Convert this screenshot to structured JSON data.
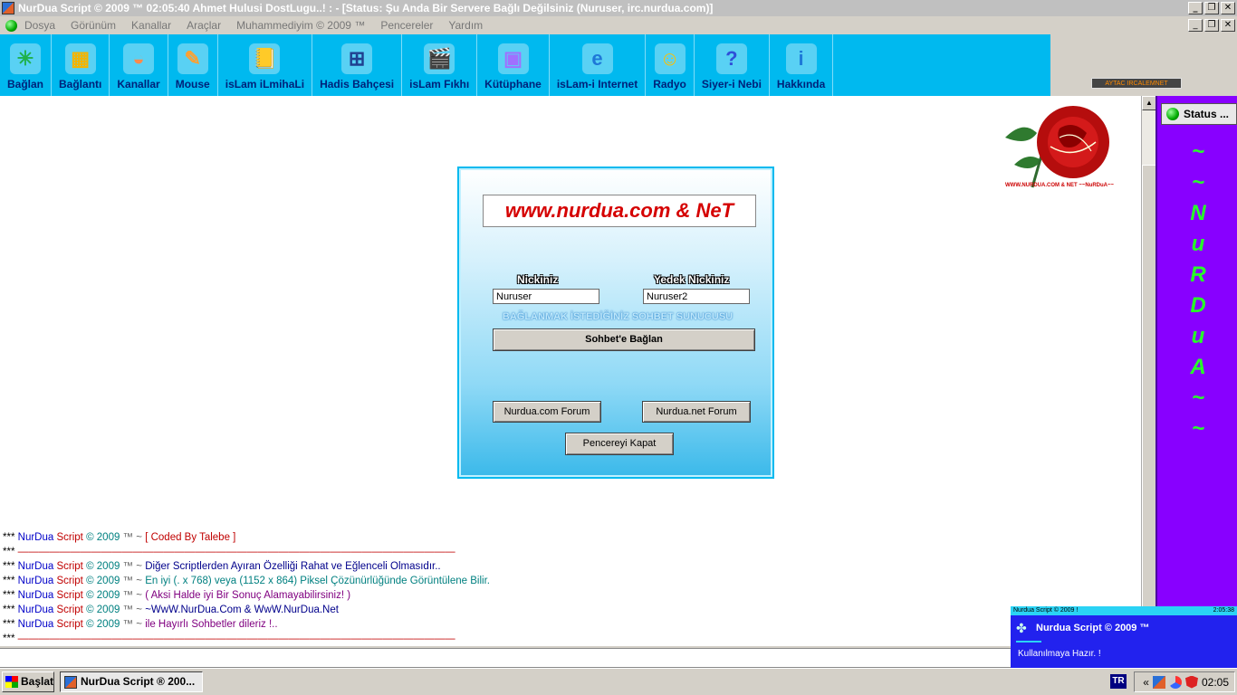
{
  "window": {
    "title": "NurDua Script © 2009 ™ 02:05:40 Ahmet Hulusi DostLugu..! : - [Status: Şu Anda Bir Servere Bağlı Değilsiniz (Nuruser, irc.nurdua.com)]",
    "min_glyph": "_",
    "restore_glyph": "❐",
    "close_glyph": "✕"
  },
  "menubar": {
    "items": [
      "Dosya",
      "Görünüm",
      "Kanallar",
      "Araçlar",
      "Muhammediyim © 2009 ™",
      "Pencereler",
      "Yardım"
    ]
  },
  "toolbar": {
    "buttons": [
      {
        "label": "Bağlan",
        "icon": "connect-icon",
        "glyph": "✳",
        "color": "#1fb14a"
      },
      {
        "label": "Bağlantı",
        "icon": "blocks-icon",
        "glyph": "▦",
        "color": "#f4b400"
      },
      {
        "label": "Kanallar",
        "icon": "bowl-icon",
        "glyph": "◒",
        "color": "#ff8a4c"
      },
      {
        "label": "Mouse",
        "icon": "tools-icon",
        "glyph": "✎",
        "color": "#ffa030"
      },
      {
        "label": "isLam iLmihaLi",
        "icon": "book-icon",
        "glyph": "📒",
        "color": "#ffcf44"
      },
      {
        "label": "Hadis Bahçesi",
        "icon": "windows-icon",
        "glyph": "⊞",
        "color": "#1f3f8f"
      },
      {
        "label": "isLam Fıkhı",
        "icon": "clapper-icon",
        "glyph": "🎬",
        "color": "#333333"
      },
      {
        "label": "Kütüphane",
        "icon": "gameboy-icon",
        "glyph": "▣",
        "color": "#a070ff"
      },
      {
        "label": "isLam-i Internet",
        "icon": "ie-icon",
        "glyph": "e",
        "color": "#1e78d8"
      },
      {
        "label": "Radyo",
        "icon": "chat-face-icon",
        "glyph": "☺",
        "color": "#ffbf00"
      },
      {
        "label": "Siyer-i Nebi",
        "icon": "help-icon",
        "glyph": "?",
        "color": "#2f4fd8"
      },
      {
        "label": "Hakkında",
        "icon": "info-icon",
        "glyph": "i",
        "color": "#1d7ad8"
      }
    ]
  },
  "brand_badge": "AYTAC IRCALEMNET",
  "rose_caption": "WWW.NURDUA.COM & NET ~~NuRDuA~~",
  "dialog": {
    "brand": "www.nurdua.com & NeT",
    "nick_label": "Nickiniz",
    "alt_nick_label": "Yedek Nickiniz",
    "nick_value": "Nuruser",
    "alt_nick_value": "Nuruser2",
    "server_label": "BAĞLANMAK İSTEDİĞİNİZ SOHBET SUNUCUSU",
    "connect_button": "Sohbet'e Bağlan",
    "forum_com_button": "Nurdua.com Forum",
    "forum_net_button": "Nurdua.net Forum",
    "close_button": "Pencereyi Kapat"
  },
  "chat_prefix": {
    "stars": "***",
    "nurdua": "NurDua",
    "script": "Script",
    "copy": "©",
    "year": "2009",
    "tm": "™",
    "sep": "~"
  },
  "chat_lines": [
    {
      "kind": "full",
      "tail": "[ Coded By Talebe ]",
      "tail_style": "k-tail-red"
    },
    {
      "kind": "dash",
      "tail": "——————————————————————————————————————————",
      "tail_style": "k-tail-red"
    },
    {
      "kind": "full",
      "tail": "Diğer Scriptlerden Ayıran Özelliği Rahat ve Eğlenceli Olmasıdır..",
      "tail_style": "k-tail-blue"
    },
    {
      "kind": "full",
      "tail": "En iyi (. x 768) veya (1152 x 864) Piksel Çözünürlüğünde Görüntülene Bilir.",
      "tail_style": "k-tail-teal"
    },
    {
      "kind": "full",
      "tail": "( Aksi Halde iyi Bir Sonuç Alamayabilirsiniz! )",
      "tail_style": "k-tail-purple"
    },
    {
      "kind": "full",
      "tail": "~WwW.NurDua.Com & WwW.NurDua.Net",
      "tail_style": "k-tail-blue"
    },
    {
      "kind": "full",
      "tail": "ile Hayırlı Sohbetler dileriz !..",
      "tail_style": "k-tail-purple"
    },
    {
      "kind": "dash",
      "tail": "——————————————————————————————————————————",
      "tail_style": "k-tail-red"
    }
  ],
  "side_panel": {
    "status_tab": "Status ...",
    "vertical_text": [
      "~",
      "~",
      "N",
      "u",
      "R",
      "D",
      "u",
      "A",
      "~",
      "~"
    ]
  },
  "toast": {
    "header_left": "Nurdua Script © 2009 !",
    "header_right": "2:05:38",
    "title": "Nurdua Script © 2009 ™",
    "message": "Kullanılmaya Hazır. !"
  },
  "taskbar": {
    "start": "Başlat",
    "task": "NurDua Script ® 200...",
    "lang": "TR",
    "clock": "02:05",
    "chevron": "«"
  },
  "colors": {
    "toolbar_bg": "#00b9ef",
    "side_panel_bg": "#8800ff",
    "toast_bg": "#2222ee",
    "accent_green": "#28ff28"
  }
}
